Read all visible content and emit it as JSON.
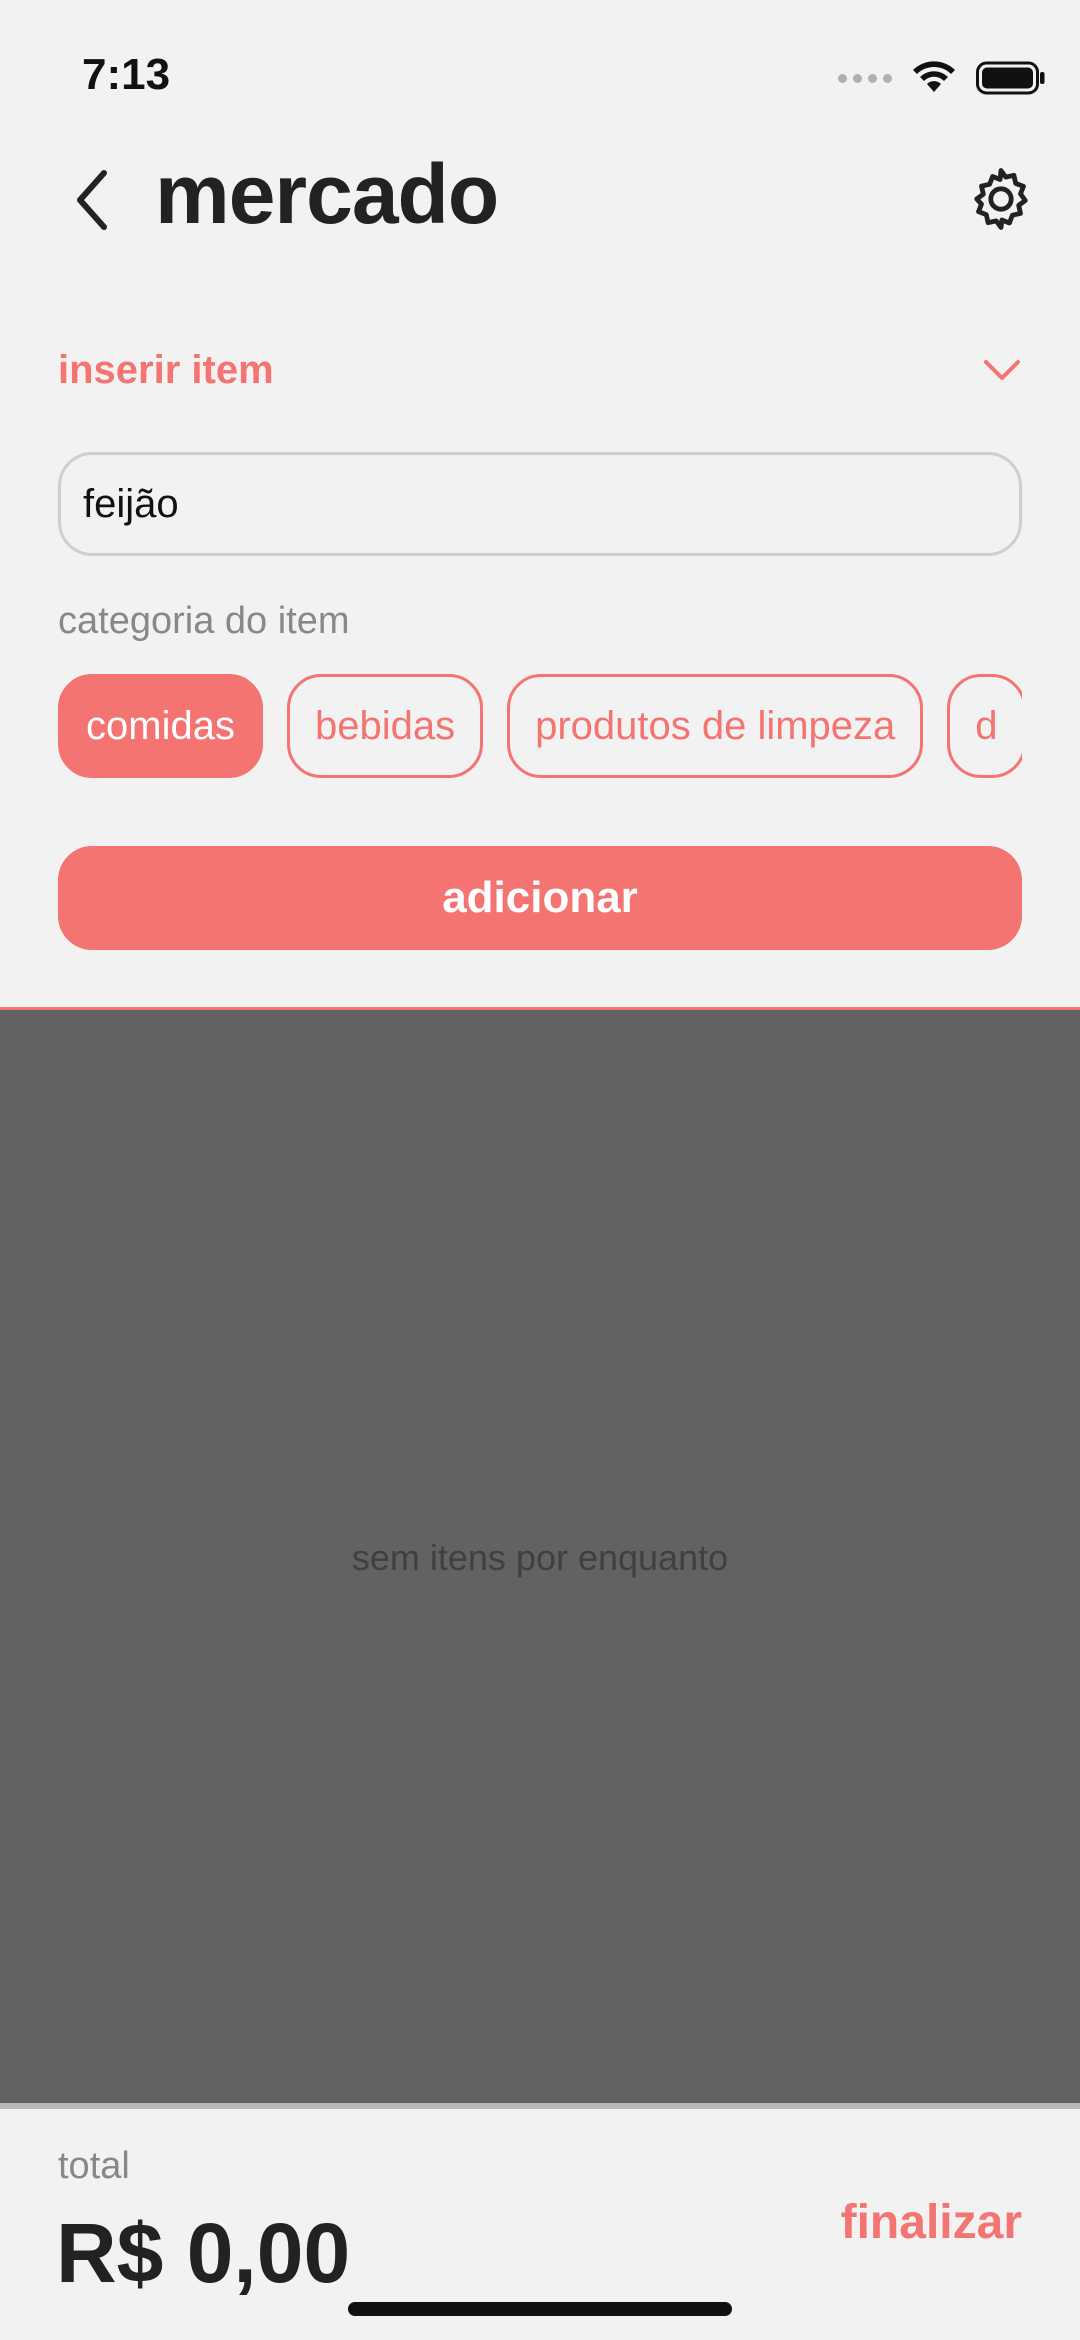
{
  "status_bar": {
    "time": "7:13"
  },
  "header": {
    "title": "mercado",
    "back_icon": "chevron-left-icon",
    "settings_icon": "gear-icon"
  },
  "insert_section": {
    "title": "inserir item",
    "toggle_icon": "chevron-down-icon",
    "input_value": "feijão",
    "category_label": "categoria do item",
    "categories": [
      {
        "label": "comidas",
        "selected": true
      },
      {
        "label": "bebidas",
        "selected": false
      },
      {
        "label": "produtos de limpeza",
        "selected": false
      },
      {
        "label": "d",
        "selected": false
      }
    ],
    "add_label": "adicionar"
  },
  "list": {
    "empty_message": "sem itens por enquanto"
  },
  "footer": {
    "total_label": "total",
    "total_value": "R$ 0,00",
    "finish_label": "finalizar"
  },
  "colors": {
    "accent": "#f37471",
    "background": "#f2f2f2",
    "overlay": "#626262"
  }
}
